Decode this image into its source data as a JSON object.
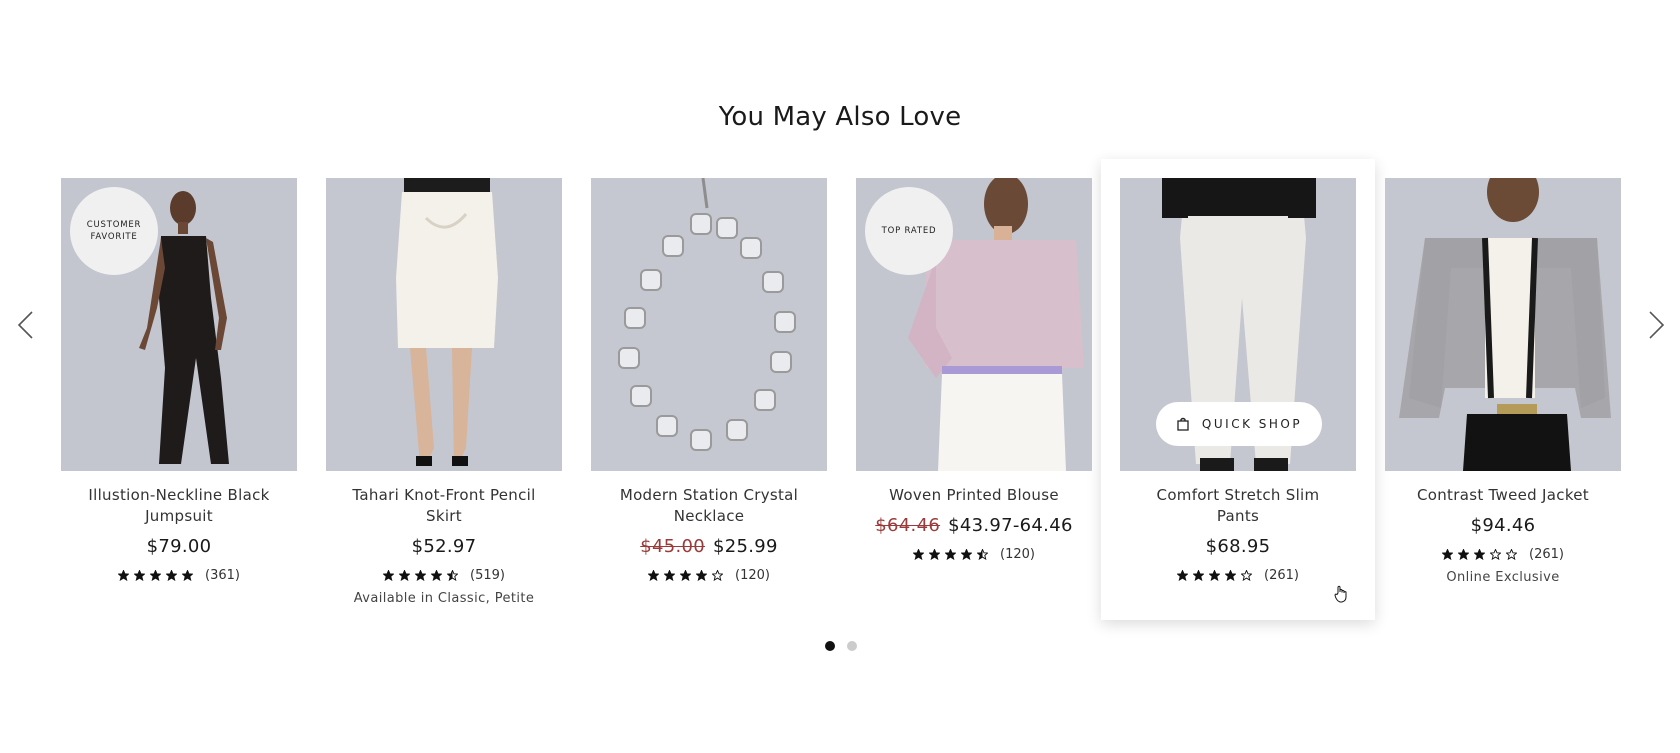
{
  "section": {
    "title": "You May Also Love"
  },
  "carousel": {
    "prev_icon": "chevron-left-icon",
    "next_icon": "chevron-right-icon",
    "pages": 2,
    "active_page": 1
  },
  "quick_shop": {
    "label": "QUICK SHOP",
    "icon": "shopping-bag-icon"
  },
  "products": [
    {
      "name": "Illustion-Neckline Black Jumpsuit",
      "badge": "CUSTOMER FAVORITE",
      "price": "$79.00",
      "old_price": "",
      "rating": 5,
      "reviews": "(361)",
      "note": ""
    },
    {
      "name": "Tahari Knot-Front Pencil Skirt",
      "badge": "",
      "price": "$52.97",
      "old_price": "",
      "rating": 4.5,
      "reviews": "(519)",
      "note": "Available in Classic, Petite"
    },
    {
      "name": "Modern Station Crystal Necklace",
      "badge": "",
      "price": "$25.99",
      "old_price": "$45.00",
      "rating": 4,
      "reviews": "(120)",
      "note": ""
    },
    {
      "name": "Woven Printed Blouse",
      "badge": "TOP RATED",
      "price": "$43.97-64.46",
      "old_price": "$64.46",
      "rating": 4.5,
      "reviews": "(120)",
      "note": ""
    },
    {
      "name": "Comfort Stretch Slim Pants",
      "badge": "",
      "price": "$68.95",
      "old_price": "",
      "rating": 4,
      "reviews": "(261)",
      "note": ""
    },
    {
      "name": "Contrast Tweed Jacket",
      "badge": "",
      "price": "$94.46",
      "old_price": "",
      "rating": 3,
      "reviews": "(261)",
      "note": "Online Exclusive"
    }
  ]
}
